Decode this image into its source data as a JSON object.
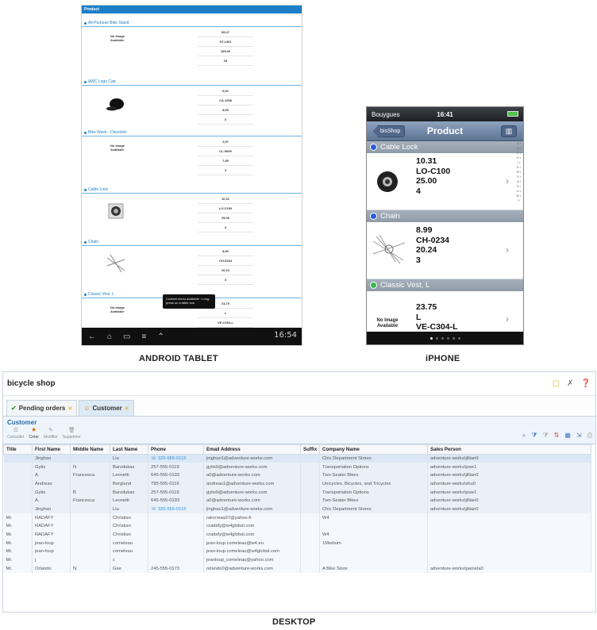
{
  "captions": {
    "tablet": "ANDROID TABLET",
    "iphone": "iPHONE",
    "desktop": "DESKTOP"
  },
  "tablet": {
    "header": "Product",
    "items": [
      {
        "title": "All-Purpose Bike Stand",
        "image": "No Image Available",
        "values": [
          "59,47",
          "ST-1401",
          "159,00",
          "25"
        ]
      },
      {
        "title": "AWC Logo Cap",
        "image": "cap",
        "values": [
          "6,92",
          "CA-1098",
          "8,99",
          "3"
        ]
      },
      {
        "title": "Bike Wash - Dissolver",
        "image": "No Image Available",
        "values": [
          "2,97",
          "CL-9009",
          "7,95",
          "3"
        ]
      },
      {
        "title": "Cable Lock",
        "image": "lock",
        "values": [
          "10,31",
          "LO-C100",
          "25,00",
          "4"
        ]
      },
      {
        "title": "Chain",
        "image": "chain",
        "values": [
          "8,99",
          "CH-0234",
          "20,24",
          "3"
        ]
      },
      {
        "title": "Classic Vest, L",
        "image": "No Image Available",
        "values": [
          "23,75",
          "L",
          "VE-C304-L"
        ]
      }
    ],
    "popup": "Context menu available : Long-press on a table row",
    "clock": "16:54"
  },
  "iphone": {
    "carrier": "Bouygues",
    "time": "16:41",
    "back": "bisShop",
    "title": "Product",
    "sections": [
      {
        "name": "Cable Lock",
        "dot_color": "#2c5ad8",
        "image": "lock",
        "values": [
          "10.31",
          "LO-C100",
          "25.00",
          "4"
        ]
      },
      {
        "name": "Chain",
        "dot_color": "#2c5ad8",
        "image": "chain",
        "values": [
          "8.99",
          "CH-0234",
          "20.24",
          "3"
        ]
      },
      {
        "name": "Classic Vest, L",
        "dot_color": "#3bb54a",
        "image": "No Image Available",
        "values": [
          "23.75",
          "L",
          "VE-C304-L"
        ]
      }
    ],
    "index_letters": "A • C • E • G • I • K • M • O • Q • S • U • W • Y"
  },
  "desktop": {
    "app_title": "bicycle shop",
    "tabs": [
      {
        "label": "Pending orders",
        "active": false
      },
      {
        "label": "Customer",
        "active": true
      }
    ],
    "panel_title": "Customer",
    "toolbar": [
      {
        "label": "Consulter",
        "enabled": false
      },
      {
        "label": "Créer",
        "enabled": true
      },
      {
        "label": "Modifier",
        "enabled": false
      },
      {
        "label": "Supprimer",
        "enabled": false
      }
    ],
    "columns": [
      "Title",
      "First Name",
      "Middle Name",
      "Last Name",
      "Phone",
      "Email Address",
      "Suffix",
      "Company Name",
      "Sales Person"
    ],
    "rows": [
      [
        "",
        "Jinghao",
        "",
        "Liu",
        "☏ 320-555-0115",
        "jinghao1@adventure-works.com",
        "",
        "Chic Department Stores",
        "adventure-works\\jillian0"
      ],
      [
        "",
        "Gytis",
        "N",
        "Barzdukas",
        "257-555-0119",
        "gytis0@adventure-works.com",
        "",
        "Transportation Options",
        "adventure-works\\jose1"
      ],
      [
        "",
        "A.",
        "Francesca",
        "Leonetti",
        "645-555-0193",
        "a0@adventure-works.com",
        "",
        "Two-Seater Bikes",
        "adventure-works\\jillian0"
      ],
      [
        "",
        "Andreas",
        "",
        "Berglund",
        "795-555-0116",
        "andreas1@adventure-works.com",
        "",
        "Unicycles, Bicycles, and Tricycles",
        "adventure-works\\shu0"
      ],
      [
        "",
        "Gytis",
        "B",
        "Barzdukas",
        "257-555-0119",
        "gytis0@adventure-works.com",
        "",
        "Transportation Options",
        "adventure-works\\jose1"
      ],
      [
        "",
        "A.",
        "Francesca",
        "Leonetti",
        "645-555-0193",
        "a0@adventure-works.com",
        "",
        "Two-Seater Bikes",
        "adventure-works\\jillian0"
      ],
      [
        "",
        "Jinghao",
        "",
        "Liu",
        "☏ 320-555-0115",
        "jinghao1@adventure-works.com",
        "",
        "Chic Department Stores",
        "adventure-works\\jillian0"
      ],
      [
        "Mr.",
        "RADAFY",
        "",
        "Christian",
        "",
        "rakvrwaa97@yahoo.fr",
        "",
        "W4",
        ""
      ],
      [
        "Mr.",
        "RADAFY",
        "",
        "Christian",
        "",
        "cradafy@w4global.com",
        "",
        "",
        ""
      ],
      [
        "Mr.",
        "RADAFY",
        "",
        "Christian",
        "",
        "cradafy@w4global.com",
        "",
        "W4",
        ""
      ],
      [
        "Mr.",
        "jean-loup",
        "",
        "comeleau",
        "",
        "jean-loup.comeleau@w4.eu",
        "",
        "1Medium",
        ""
      ],
      [
        "Mr.",
        "jean-loup",
        "",
        "comeleau",
        "",
        "jean-loup.comeleau@w4global.com",
        "",
        "",
        ""
      ],
      [
        "Mr.",
        "j",
        "",
        "c",
        "",
        "jeanloup_comeleau@yahoo.com",
        "",
        "",
        ""
      ],
      [
        "Mr.",
        "Orlando",
        "N.",
        "Gee",
        "245-555-0173",
        "orlando0@adventure-works.com",
        "",
        "A Bike Store",
        "adventure-works\\pamela0"
      ]
    ]
  }
}
